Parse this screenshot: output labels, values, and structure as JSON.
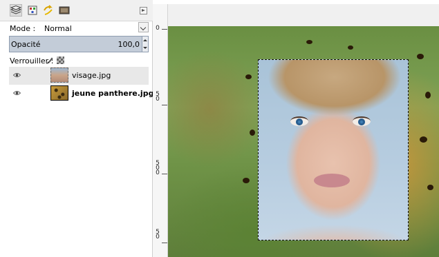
{
  "layers_panel": {
    "tabs": [
      {
        "icon": "layers-icon",
        "active": true
      },
      {
        "icon": "channels-icon",
        "active": false
      },
      {
        "icon": "paths-icon",
        "active": false
      },
      {
        "icon": "history-icon",
        "active": false
      }
    ],
    "mode_label": "Mode :",
    "mode_value": "Normal",
    "opacity_label": "Opacité",
    "opacity_value": "100,0",
    "lock_label": "Verrouiller :",
    "layers": [
      {
        "name": "visage.jpg",
        "visible": true,
        "active": false
      },
      {
        "name": "jeune panthere.jpg",
        "visible": true,
        "active": true
      }
    ]
  },
  "ruler": {
    "labels": [
      "0",
      "5\n0",
      "5\n0\n0",
      "5\n0"
    ]
  },
  "colors": {
    "panel_bg": "#ffffff",
    "opacity_bar": "#c3ccd8",
    "selected_row": "#e8e8e8"
  }
}
